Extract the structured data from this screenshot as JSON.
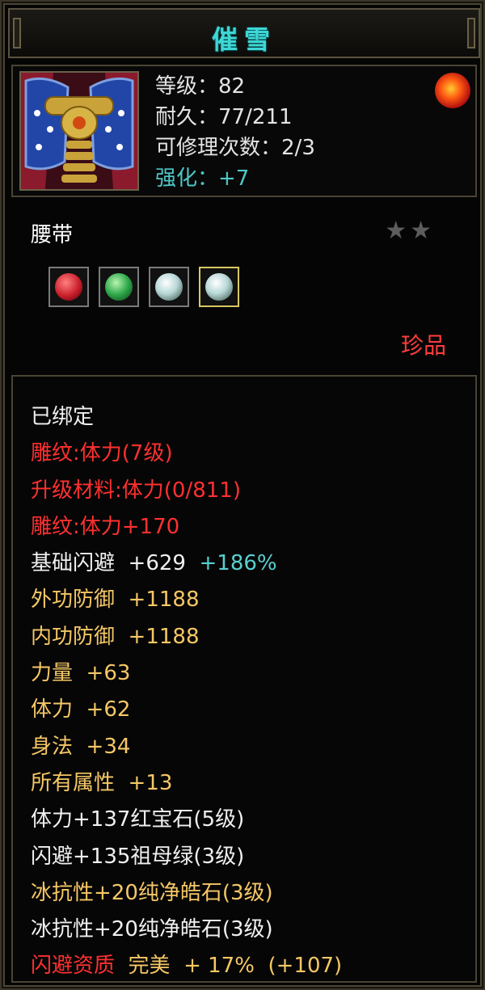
{
  "title": "催雪",
  "header": {
    "stats": [
      {
        "label": "等级：",
        "value": "82"
      },
      {
        "label": "耐久：",
        "value": "77/211"
      },
      {
        "label": "可修理次数：",
        "value": "2/3"
      },
      {
        "label": "强化：",
        "value": "+7"
      }
    ],
    "icon": "belt-item-icon",
    "badge_icon": "dragon-emblem-icon"
  },
  "item_name": "腰带",
  "stars": "★★",
  "star_count": 2,
  "gems": [
    {
      "name": "ruby-gem-icon",
      "color": "#c81e2a"
    },
    {
      "name": "emerald-gem-icon",
      "color": "#2ea84a"
    },
    {
      "name": "diamond-gem-icon",
      "color": "#cfe8e8"
    },
    {
      "name": "diamond-gem-icon",
      "color": "#cfe8e8"
    }
  ],
  "quality": "珍品",
  "attributes": {
    "bound": "已绑定",
    "engrave_1": "雕纹:体力(7级)",
    "upgrade_material": "升级材料:体力(0/811)",
    "engrave_2": "雕纹:体力+170",
    "dodge": {
      "label": "基础闪避",
      "value": "+629",
      "bonus": "+186%"
    },
    "outer_def": {
      "label": "外功防御",
      "value": "+1188"
    },
    "inner_def": {
      "label": "内功防御",
      "value": "+1188"
    },
    "strength": {
      "label": "力量",
      "value": "+63"
    },
    "stamina": {
      "label": "体力",
      "value": "+62"
    },
    "agility": {
      "label": "身法",
      "value": "+34"
    },
    "all_attr": {
      "label": "所有属性",
      "value": "+13"
    },
    "gem_1": "体力+137红宝石(5级)",
    "gem_2": "闪避+135祖母绿(3级)",
    "gem_3": "冰抗性+20纯净皓石(3级)",
    "gem_4": "冰抗性+20纯净皓石(3级)",
    "aptitude": {
      "label": "闪避资质",
      "grade": "完美",
      "value": "+ 17%",
      "extra": "(+107)"
    }
  },
  "colors": {
    "title": "#3fd6d6",
    "red": "#ff3030",
    "gold": "#f5c766",
    "cyan": "#58d0d0"
  }
}
